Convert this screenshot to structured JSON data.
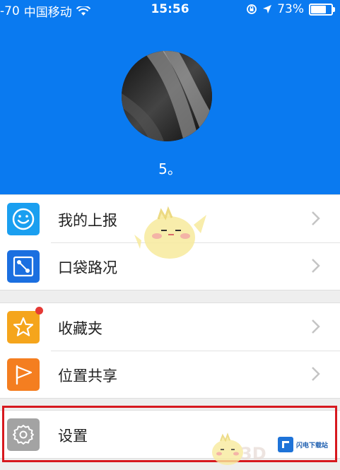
{
  "status_bar": {
    "signal": "-70",
    "carrier": "中国移动",
    "time": "15:56",
    "battery": "73%"
  },
  "profile": {
    "username": "5。"
  },
  "menu_group_1": [
    {
      "label": "我的上报",
      "icon": "smiley-icon",
      "color": "#1a9ff0"
    },
    {
      "label": "口袋路况",
      "icon": "map-route-icon",
      "color": "#1b6fe0"
    }
  ],
  "menu_group_2": [
    {
      "label": "收藏夹",
      "icon": "star-icon",
      "color": "#f5a51c"
    },
    {
      "label": "位置共享",
      "icon": "flag-icon",
      "color": "#f47e20"
    }
  ],
  "menu_group_3": [
    {
      "label": "设置",
      "icon": "gear-icon",
      "color": "#a3a3a3"
    }
  ],
  "watermark": {
    "text": "闪电下载站",
    "partial": "3D"
  },
  "colors": {
    "header_bg": "#0a7af0",
    "highlight": "#d7191f"
  }
}
